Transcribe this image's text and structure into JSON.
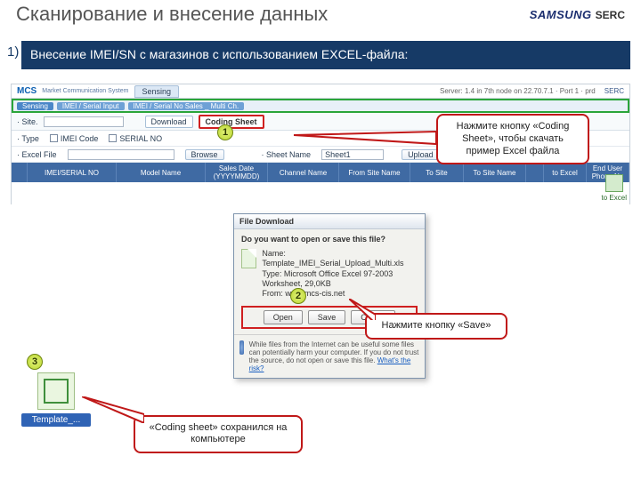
{
  "slide": {
    "title": "Сканирование и внесение данных",
    "list_number": "1)",
    "subtitle": "Внесение IMEI/SN с магазинов с использованием EXCEL-файла:"
  },
  "brand": {
    "name": "SAMSUNG",
    "unit": "SERC"
  },
  "app": {
    "product": "MCS",
    "product_sub": "Market Communication System",
    "tab": "Sensing",
    "location": "Server: 1.4 in 7th node on 22.70.7.1 · Port 1 · prd",
    "loc_label": "SERC",
    "breadcrumb": [
      "Sensing",
      "IMEI / Serial Input",
      "IMEI / Serial No Sales _ Multi Ch."
    ],
    "toolbar": {
      "download": "Download",
      "coding": "Coding Sheet"
    },
    "form": {
      "site_label": "· Site.",
      "type_label": "· Type",
      "type_imei": "IMEI Code",
      "type_serial": "SERIAL NO",
      "file_label": "· Excel File",
      "browse": "Browse",
      "sheet_label": "· Sheet Name",
      "sheet_value": "Sheet1",
      "upload": "Upload"
    },
    "grid": {
      "cols": [
        "",
        "IMEI/SERIAL NO",
        "Model Name",
        "Sales Date (YYYYMMDD)",
        "Channel Name",
        "From Site Name",
        "To Site",
        "To Site Name",
        "",
        "to Excel",
        "End User Phone No"
      ]
    }
  },
  "right_icon": {
    "label": "to Excel"
  },
  "dialog": {
    "title": "File Download",
    "question": "Do you want to open or save this file?",
    "name_l": "Name:",
    "name_v": "Template_IMEI_Serial_Upload_Multi.xls",
    "type_l": "Type:",
    "type_v": "Microsoft Office Excel 97-2003 Worksheet, 29,0KB",
    "from_l": "From:",
    "from_v": "www.mcs-cis.net",
    "open": "Open",
    "save": "Save",
    "cancel": "Cancel",
    "foot": "While files from the Internet can be useful some files can potentially harm your computer. If you do not trust the source, do not open or save this file.",
    "risk": "What's the risk?"
  },
  "callouts": {
    "c1": "Нажмите кнопку «Coding Sheet», чтобы скачать\nпример Excel файла",
    "c2": "Нажмите кнопку «Save»",
    "c3": "«Coding sheet» сохранился на компьютере"
  },
  "badges": {
    "b1": "1",
    "b2": "2",
    "b3": "3"
  },
  "desktop": {
    "label": "Template_..."
  }
}
